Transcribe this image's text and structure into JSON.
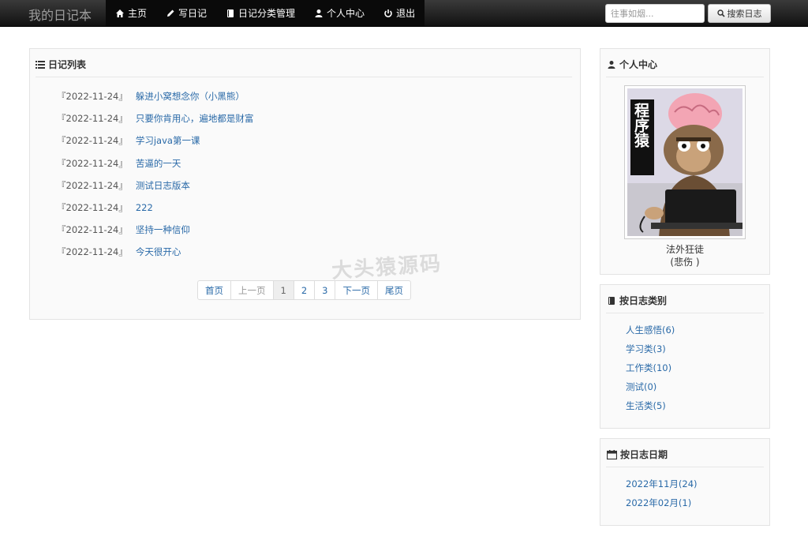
{
  "navbar": {
    "brand": "我的日记本",
    "items": [
      {
        "label": "主页",
        "icon": "home-icon"
      },
      {
        "label": "写日记",
        "icon": "pencil-icon"
      },
      {
        "label": "日记分类管理",
        "icon": "book-icon"
      },
      {
        "label": "个人中心",
        "icon": "user-icon"
      },
      {
        "label": "退出",
        "icon": "power-icon"
      }
    ],
    "search_placeholder": "往事如烟...",
    "search_button": "搜索日志"
  },
  "diary_panel": {
    "title": "日记列表",
    "entries": [
      {
        "date": "『2022-11-24』",
        "title": "躲进小窝想念你（小黑熊）"
      },
      {
        "date": "『2022-11-24』",
        "title": "只要你肯用心，遍地都是财富"
      },
      {
        "date": "『2022-11-24』",
        "title": "学习java第一课"
      },
      {
        "date": "『2022-11-24』",
        "title": "苦逼的一天"
      },
      {
        "date": "『2022-11-24』",
        "title": "测试日志版本"
      },
      {
        "date": "『2022-11-24』",
        "title": "222"
      },
      {
        "date": "『2022-11-24』",
        "title": "坚持一种信仰"
      },
      {
        "date": "『2022-11-24』",
        "title": "今天很开心"
      }
    ],
    "pagination": {
      "first": "首页",
      "prev": "上一页",
      "pages": [
        "1",
        "2",
        "3"
      ],
      "current": "1",
      "next": "下一页",
      "last": "尾页"
    }
  },
  "watermark": "大头猿源码",
  "profile_panel": {
    "title": "个人中心",
    "avatar_text": "程序猿",
    "nickname": "法外狂徒",
    "mood": "(悲伤 )"
  },
  "category_panel": {
    "title": "按日志类别",
    "items": [
      "人生感悟(6)",
      "学习类(3)",
      "工作类(10)",
      "测试(0)",
      "生活类(5)"
    ]
  },
  "date_panel": {
    "title": "按日志日期",
    "items": [
      "2022年11月(24)",
      "2022年02月(1)"
    ]
  },
  "colors": {
    "link": "#2a6aa8",
    "navbar": "#111111",
    "panel_bg": "#fafafa"
  }
}
